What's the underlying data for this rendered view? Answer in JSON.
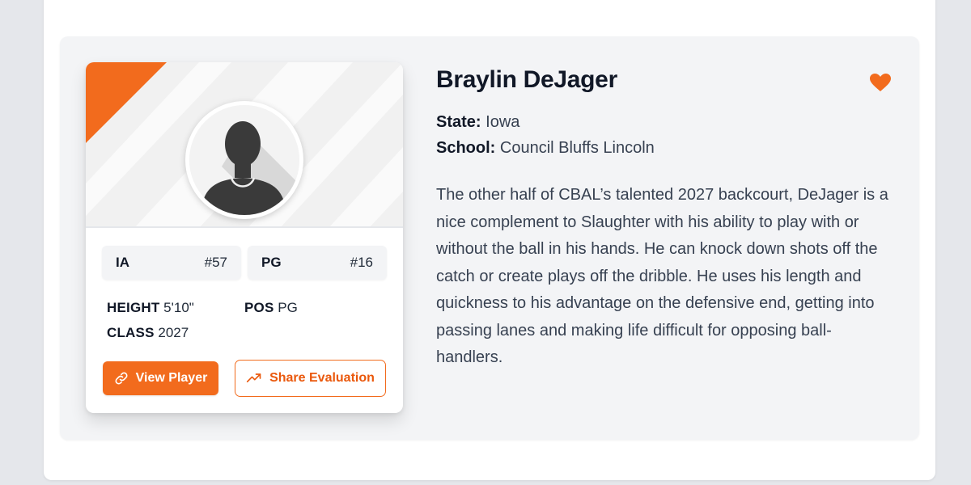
{
  "player": {
    "name": "Braylin DeJager",
    "state_label": "State:",
    "state": "Iowa",
    "school_label": "School:",
    "school": "Council Bluffs Lincoln",
    "evaluation": "The other half of CBAL’s talented 2027 backcourt, DeJager is a nice complement to Slaughter with his ability to play with or without the ball in his hands. He can knock down shots off the catch or create plays off the dribble. He uses his length and quickness to his advantage on the defensive end, getting into passing lanes and making life difficult for opposing ball-handlers."
  },
  "card": {
    "state_rank": {
      "label": "IA",
      "value": "#57"
    },
    "position_rank": {
      "label": "PG",
      "value": "#16"
    },
    "height_label": "HEIGHT",
    "height": "5'10\"",
    "class_label": "CLASS",
    "class_year": "2027",
    "pos_label": "POS",
    "pos": "PG",
    "view_button": "View Player",
    "share_button": "Share Evaluation"
  },
  "icons": {
    "favorite": "heart-icon",
    "view": "link-icon",
    "share": "trending-up-icon",
    "avatar": "person-silhouette-icon"
  },
  "colors": {
    "accent": "#f26b1d",
    "text_dark": "#111827",
    "text_body": "#374151",
    "card_bg": "#f3f4f6"
  }
}
